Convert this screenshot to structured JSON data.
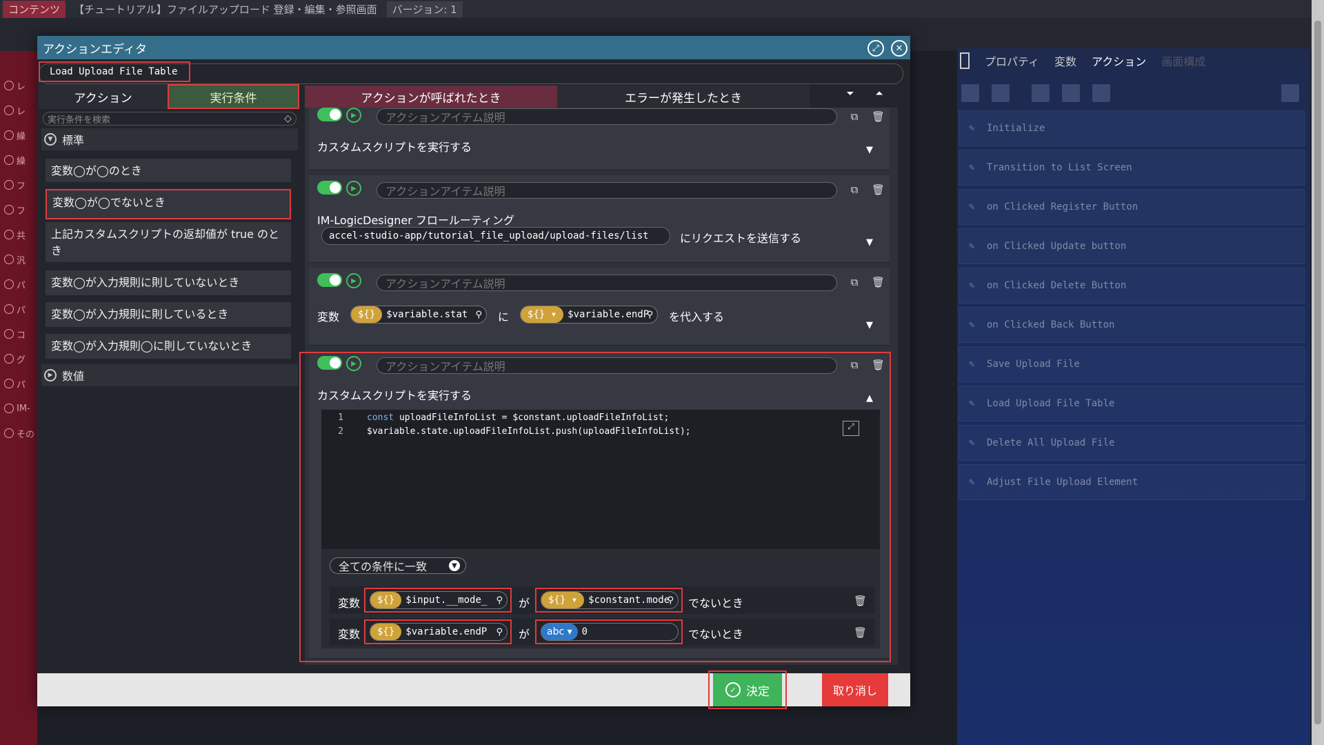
{
  "app": {
    "tag": "コンテンツ",
    "title": "【チュートリアル】ファイルアップロード 登録・編集・参照画面",
    "version": "バージョン: 1"
  },
  "left_panel_items": [
    "レ",
    "レ",
    "繰",
    "繰",
    "フ",
    "フ",
    "共",
    "汎",
    "パ",
    "パ",
    "コ",
    "グ",
    "パ",
    "IM-",
    "その"
  ],
  "right_panel": {
    "tabs": [
      "プロパティ",
      "変数",
      "アクション",
      "画面構成"
    ],
    "active_tab": "アクション",
    "actions": [
      "Initialize",
      "Transition to List Screen",
      "on Clicked Register Button",
      "on Clicked Update button",
      "on Clicked Delete Button",
      "on Clicked Back Button",
      "Save Upload File",
      "Load Upload File Table",
      "Delete All Upload File",
      "Adjust File Upload Element"
    ]
  },
  "modal": {
    "title": "アクションエディタ",
    "action_name": "Load Upload File Table",
    "left_tabs": [
      "アクション",
      "実行条件"
    ],
    "search_placeholder": "実行条件を検索",
    "group_standard": "標準",
    "group_numeric": "数値",
    "conditions": [
      "変数◯が◯のとき",
      "変数◯が◯でないとき",
      "上記カスタムスクリプトの返却値が true のとき",
      "変数◯が入力規則に則していないとき",
      "変数◯が入力規則に則しているとき",
      "変数◯が入力規則◯に則していないとき"
    ],
    "event_tabs": [
      "アクションが呼ばれたとき",
      "エラーが発生したとき"
    ],
    "item_desc_placeholder": "アクションアイテム説明",
    "items": [
      {
        "title": "カスタムスクリプトを実行する"
      },
      {
        "title": "IM-LogicDesigner フロールーティング",
        "url": "accel-studio-app/tutorial_file_upload/upload-files/list",
        "suffix": "にリクエストを送信する"
      },
      {
        "label_var": "変数",
        "var1": "$variable.stat",
        "mid": "に",
        "var2": "$variable.endP",
        "suffix": "を代入する"
      },
      {
        "title": "カスタムスクリプトを実行する"
      }
    ],
    "code_lines": [
      {
        "n": "1",
        "kw": "const",
        "text": " uploadFileInfoList = $constant.uploadFileInfoList;"
      },
      {
        "n": "2",
        "kw": "",
        "text": "$variable.state.uploadFileInfoList.push(uploadFileInfoList);"
      }
    ],
    "match_mode": "全ての条件に一致",
    "cond_rows": [
      {
        "label": "変数",
        "left": "$input.__mode_",
        "ga": "が",
        "right_type": "${}",
        "right": "$constant.mode",
        "tail": "でないとき"
      },
      {
        "label": "変数",
        "left": "$variable.endP",
        "ga": "が",
        "right_type": "abc",
        "right": "0",
        "tail": "でないとき"
      }
    ],
    "ok_label": "決定",
    "cancel_label": "取り消し"
  },
  "colors": {
    "accent_green": "#3fbf5a",
    "highlight_red": "#e03b3b",
    "title_bar": "#356e8a",
    "var_chip": "#d0a23a",
    "abc_chip": "#2f79c8"
  }
}
